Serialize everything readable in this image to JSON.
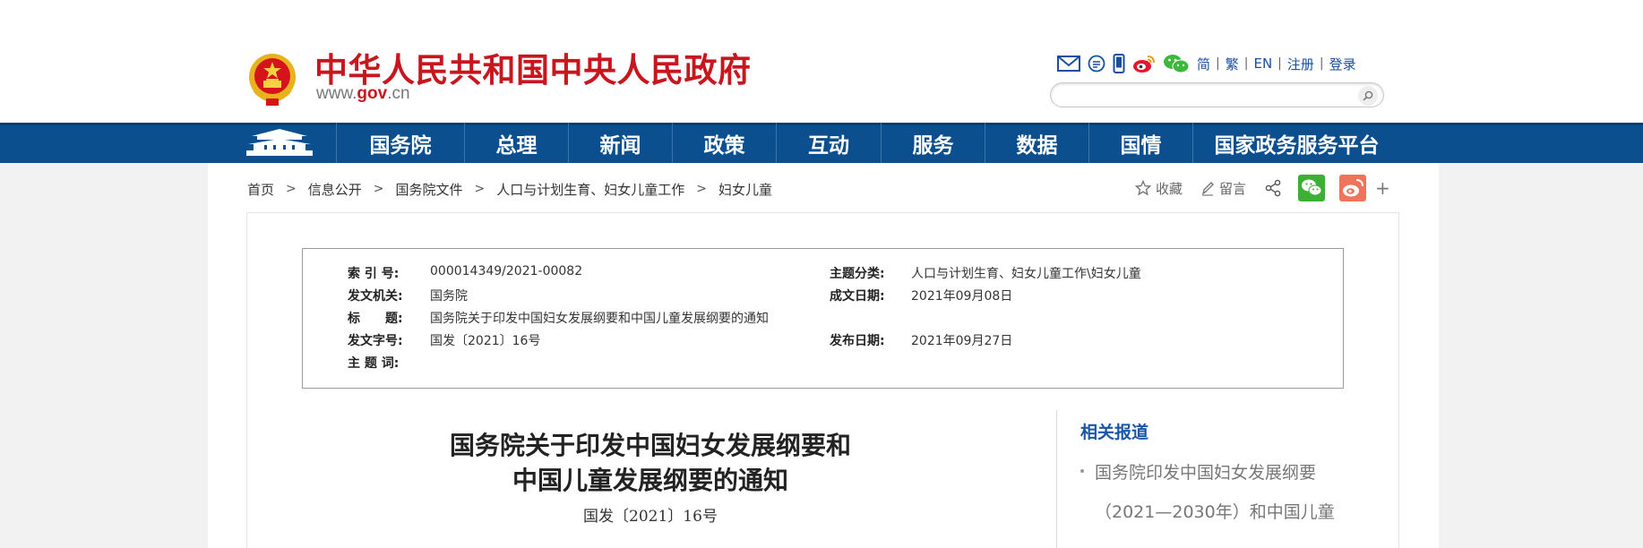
{
  "header": {
    "site_title": "中华人民共和国中央人民政府",
    "domain_prefix": "www.",
    "domain_gov": "gov",
    "domain_suffix": ".cn",
    "top_links": [
      "简",
      "繁",
      "EN",
      "注册",
      "登录"
    ],
    "icons": [
      "mail-icon",
      "chat-icon",
      "mobile-icon",
      "weibo-icon",
      "wechat-icon"
    ],
    "search_placeholder": ""
  },
  "nav": {
    "items": [
      "国务院",
      "总理",
      "新闻",
      "政策",
      "互动",
      "服务",
      "数据",
      "国情",
      "国家政务服务平台"
    ]
  },
  "breadcrumb": [
    "首页",
    "信息公开",
    "国务院文件",
    "人口与计划生育、妇女儿童工作",
    "妇女儿童"
  ],
  "share": {
    "favorite_label": "收藏",
    "comment_label": "留言",
    "plus": "+"
  },
  "info": {
    "index_label": "索 引 号:",
    "index_value": "000014349/2021-00082",
    "topic_label": "主题分类:",
    "topic_value": "人口与计划生育、妇女儿童工作\\妇女儿童",
    "issuer_label": "发文机关:",
    "issuer_value": "国务院",
    "created_label": "成文日期:",
    "created_value": "2021年09月08日",
    "title_label": "标　　题:",
    "title_value": "国务院关于印发中国妇女发展纲要和中国儿童发展纲要的通知",
    "docno_label": "发文字号:",
    "docno_value": "国发〔2021〕16号",
    "published_label": "发布日期:",
    "published_value": "2021年09月27日",
    "keywords_label": "主 题 词:",
    "keywords_value": ""
  },
  "article": {
    "title_line1": "国务院关于印发中国妇女发展纲要和",
    "title_line2": "中国儿童发展纲要的通知",
    "number": "国发〔2021〕16号"
  },
  "related": {
    "title": "相关报道",
    "line1": "国务院印发中国妇女发展纲要",
    "line2": "（2021—2030年）和中国儿童"
  }
}
